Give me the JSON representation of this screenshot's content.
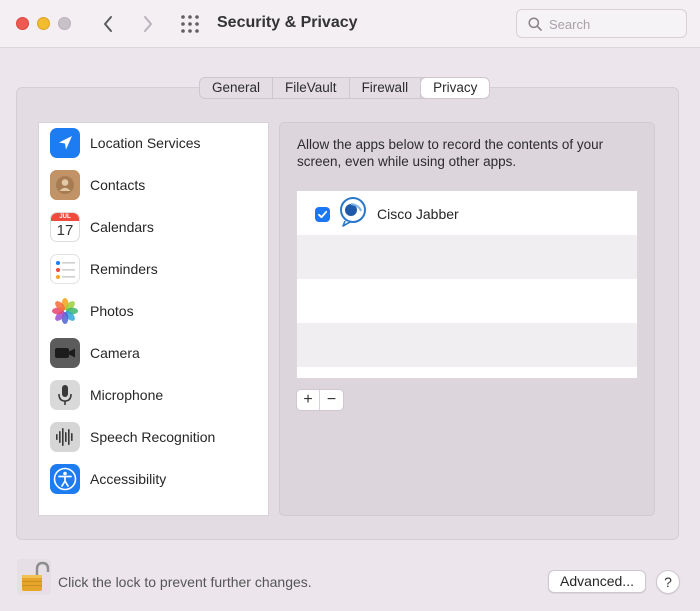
{
  "window": {
    "title": "Security & Privacy",
    "search_placeholder": "Search"
  },
  "tabs": [
    {
      "label": "General",
      "active": false
    },
    {
      "label": "FileVault",
      "active": false
    },
    {
      "label": "Firewall",
      "active": false
    },
    {
      "label": "Privacy",
      "active": true
    }
  ],
  "sidebar": {
    "items": [
      {
        "label": "Location Services",
        "icon": "location-arrow-icon"
      },
      {
        "label": "Contacts",
        "icon": "contacts-icon"
      },
      {
        "label": "Calendars",
        "icon": "calendar-icon",
        "icon_month": "JUL",
        "icon_day": "17"
      },
      {
        "label": "Reminders",
        "icon": "reminders-icon"
      },
      {
        "label": "Photos",
        "icon": "photos-icon"
      },
      {
        "label": "Camera",
        "icon": "camera-icon"
      },
      {
        "label": "Microphone",
        "icon": "microphone-icon"
      },
      {
        "label": "Speech Recognition",
        "icon": "speech-waveform-icon"
      },
      {
        "label": "Accessibility",
        "icon": "accessibility-icon"
      }
    ]
  },
  "content": {
    "description": "Allow the apps below to record the contents of your screen, even while using other apps.",
    "apps": [
      {
        "name": "Cisco Jabber",
        "checked": true,
        "icon": "cisco-jabber-icon"
      }
    ],
    "add_label": "+",
    "remove_label": "−"
  },
  "footer": {
    "lock_text": "Click the lock to prevent further changes.",
    "advanced_label": "Advanced...",
    "help_label": "?"
  },
  "colors": {
    "accent": "#1b78f2",
    "close": "#ee5a52",
    "minimize": "#f3bb2e"
  }
}
